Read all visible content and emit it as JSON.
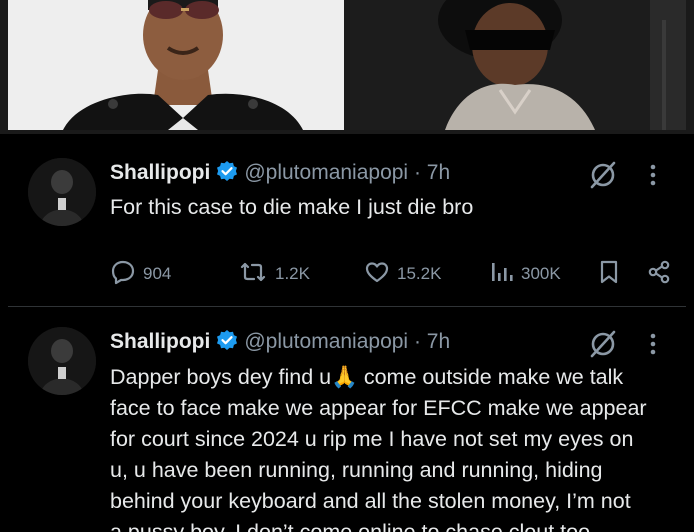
{
  "tweets": [
    {
      "name": "Shallipopi",
      "handle": "@plutomaniapopi",
      "separator": "·",
      "time": "7h",
      "text": "For this case to die make I just die bro",
      "replies": "904",
      "reposts": "1.2K",
      "likes": "15.2K",
      "views": "300K"
    },
    {
      "name": "Shallipopi",
      "handle": "@plutomaniapopi",
      "separator": "·",
      "time": "7h",
      "lines": [
        "Dapper boys dey find u🙏 come outside make we talk",
        "face to face make we appear for EFCC make we appear",
        "for court since 2024 u rip me I have not set my eyes on",
        "u, u have been running, running and running, hiding",
        "behind your keyboard and all the stolen money, I’m not",
        "a pussy boy, I don’t come online to chase clout too"
      ]
    }
  ],
  "colors": {
    "background": "#000000",
    "text": "#e7e9ea",
    "secondary": "#8b98a5",
    "verified": "#1d9bf0",
    "divider": "#2f3336"
  },
  "icons": [
    "verified-badge-icon",
    "grok-icon",
    "more-icon",
    "reply-icon",
    "repost-icon",
    "like-icon",
    "views-icon",
    "bookmark-icon",
    "share-icon"
  ]
}
